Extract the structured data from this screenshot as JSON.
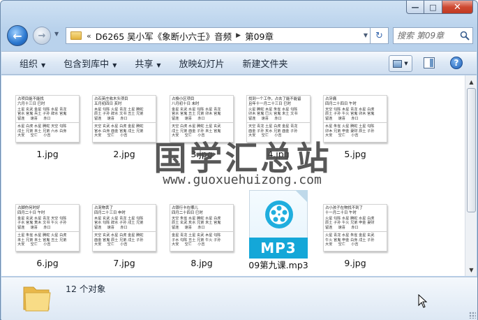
{
  "window": {
    "caption": {
      "minimize": "—",
      "maximize": "□",
      "close": "✕"
    }
  },
  "nav": {
    "back_icon": "back-arrow-icon",
    "forward_icon": "forward-arrow-icon",
    "breadcrumb": [
      "D6265 吴小军《象断小六壬》音频",
      "第09章"
    ],
    "breadcrumb_lead": "«",
    "search_placeholder": "搜索 第09章"
  },
  "toolbar": {
    "organize": "组织",
    "include_in_library": "包含到库中",
    "share": "共享",
    "slideshow": "放映幻灯片",
    "new_folder": "新建文件夹"
  },
  "files": [
    {
      "name": "1.jpg",
      "type": "jpg",
      "head": [
        "占项目能不能找",
        "六月十三日 巳时"
      ],
      "grid1": "土星 玄武 金星 勾陈 水星 青龙\n官水 官鬼 兵土 子孙 辞水 官鬼\n留连     速喜     赤口",
      "grid2": "水星 白虎 水星 腾蛇 天空 勾陈\n戌土 兄弟 未土 兄弟 六水 白身\n大安     空亡     小吉"
    },
    {
      "name": "2.jpg",
      "type": "jpg",
      "head": [
        "占石英庄收木头项目",
        "五月初四日 亥时"
      ],
      "grid1": "木星 勾陈 火星 青龙 土星 腾蛇\n辰土 子孙 辞水 文书 丑土 兄弟\n留连     速喜     赤口",
      "grid2": "天空 玄武 水星 白虎 金星 腾蛇\n官水 白身 酉金 官鬼 戌土 兄弟\n大安     空亡     小吉"
    },
    {
      "name": "3.jpg",
      "type": "jpg",
      "head": [
        "占換小区项目",
        "八月初十日 未时"
      ],
      "grid1": "金星 玄武 水星 勾陈 水星 青龙\n官水 官鬼 丑土 兄弟 卯木 官鬼\n留连     速喜     赤口",
      "grid2": "天空 白虎 水星 腾蛇 土星 玄武\n戌土 兄弟 酉金 子孙 未土 官鬼\n大安     空亡     小吉"
    },
    {
      "name": "4.jpg",
      "type": "jpg",
      "head": [
        "找到一个工作，占去了能不能留",
        "且年十一月二十三日 巳时"
      ],
      "grid1": "火星 腾蛇 木星 朱雀 水星 勾陈\n卯木 官鬼 巳火 官鬼 未土 文书\n留连     速喜     赤口",
      "grid2": "天空 青龙 土星 白虎 金星 青龙\n酉金 子孙 亥水 兄弟 酉金 子孙\n大安     空亡     小吉"
    },
    {
      "name": "5.jpg",
      "type": "jpg",
      "head": [
        "占牙痛",
        "四月二十四日 午时"
      ],
      "grid1": "天空 勾陈 木星 青龙 水星 白虎\n辰土 子孙 午火 官鬼 卯木 官鬼\n留连     速喜     赤口",
      "grid2": "水星 朱雀 火星 腾蛇 土星 勾陈\n卯木 兄弟 申金 妻财 辰土 子孙\n大安     空亡     小吉"
    },
    {
      "name": "6.jpg",
      "type": "jpg",
      "head": [
        "占脚伤何时好",
        "四月二十日 午时"
      ],
      "grid1": "金星 玄武 水星 青龙 天空 勾陈\n子水 官鬼 寅木 文书 午火 子孙\n留连     速喜     赤口",
      "grid2": "土星 朱雀 水星 腾蛇 火星 白虎\n未土 兄弟 未土 官鬼 丑土 兄弟\n大安     空亡     小吉"
    },
    {
      "name": "7.jpg",
      "type": "jpg",
      "head": [
        "占宠物丢了",
        "四月二十三日 申时"
      ],
      "grid1": "木星 玄武 火星 青龙 土星 勾陈\n官水 勾陈 辞水 子孙 戌土 兄弟\n留连     速喜     赤口",
      "grid2": "天空 玄武 水星 白虎 金星 腾蛇\n酉金 官鬼 辰土 兄弟 戌土 子孙\n大安     空亡     小吉"
    },
    {
      "name": "8.jpg",
      "type": "jpg",
      "head": [
        "占银行卡在哪儿",
        "四月二十四日 巳时"
      ],
      "grid1": "天空 朱雀 水星 腾蛇 水星 白虎\n辰土 玄武 亥水 兄弟 未土 官鬼\n留连     速喜     赤口",
      "grid2": "金星 青龙 土星 玄武 木星 勾陈\n子水 勾陈 丑土 兄弟 午火 子孙\n大安     空亡     小吉"
    },
    {
      "name": "09第九课.mp3",
      "type": "mp3",
      "badge": "MP3"
    },
    {
      "name": "9.jpg",
      "type": "jpg",
      "head": [
        "占小孩子在物找不到了",
        "十一月二十日 午时"
      ],
      "grid1": "火星 勾陈 水星 腾蛇 水星 白虎\n辰土 子孙 午火 兄弟 申金 妻财\n留连     速喜     赤口",
      "grid2": "火星 青龙 水星 朱雀 金星 玄武\n午火 官鬼 申金 白身 戌土 子孙\n大安     空亡     小吉"
    }
  ],
  "watermark": {
    "title": "国学汇总站",
    "url": "www.guoxuehuizong.com"
  },
  "details": {
    "count": "12 个对象"
  },
  "colors": {
    "accent": "#14a7d8",
    "frame": "#b9d2ec",
    "close": "#c03a22"
  }
}
